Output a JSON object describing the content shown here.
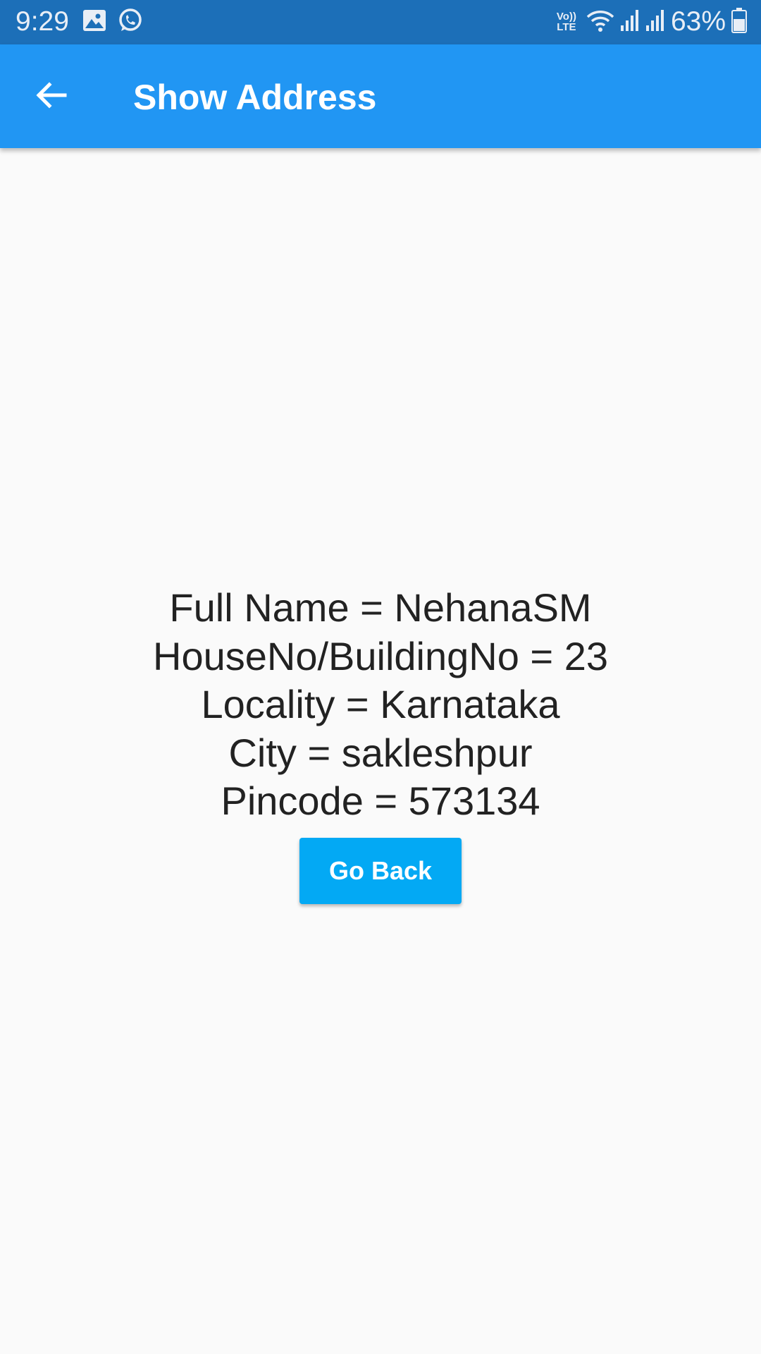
{
  "status_bar": {
    "time": "9:29",
    "battery_percent": "63%",
    "network_label_top": "Vo))",
    "network_label_bottom": "LTE",
    "battery_level": 0.63,
    "icons": [
      "gallery-icon",
      "whatsapp-icon",
      "volte-icon",
      "wifi-icon",
      "signal-icon",
      "signal-icon",
      "battery-icon"
    ]
  },
  "app_bar": {
    "title": "Show Address",
    "back_icon": "arrow-back-icon",
    "background": "#2196f3"
  },
  "address": {
    "full_name": "Full Name = NehanaSM",
    "house_no": "HouseNo/BuildingNo = 23",
    "locality": "Locality = Karnataka",
    "city": "City = sakleshpur",
    "pincode": "Pincode = 573134"
  },
  "actions": {
    "go_back_label": "Go Back",
    "button_color": "#03a9f4"
  }
}
